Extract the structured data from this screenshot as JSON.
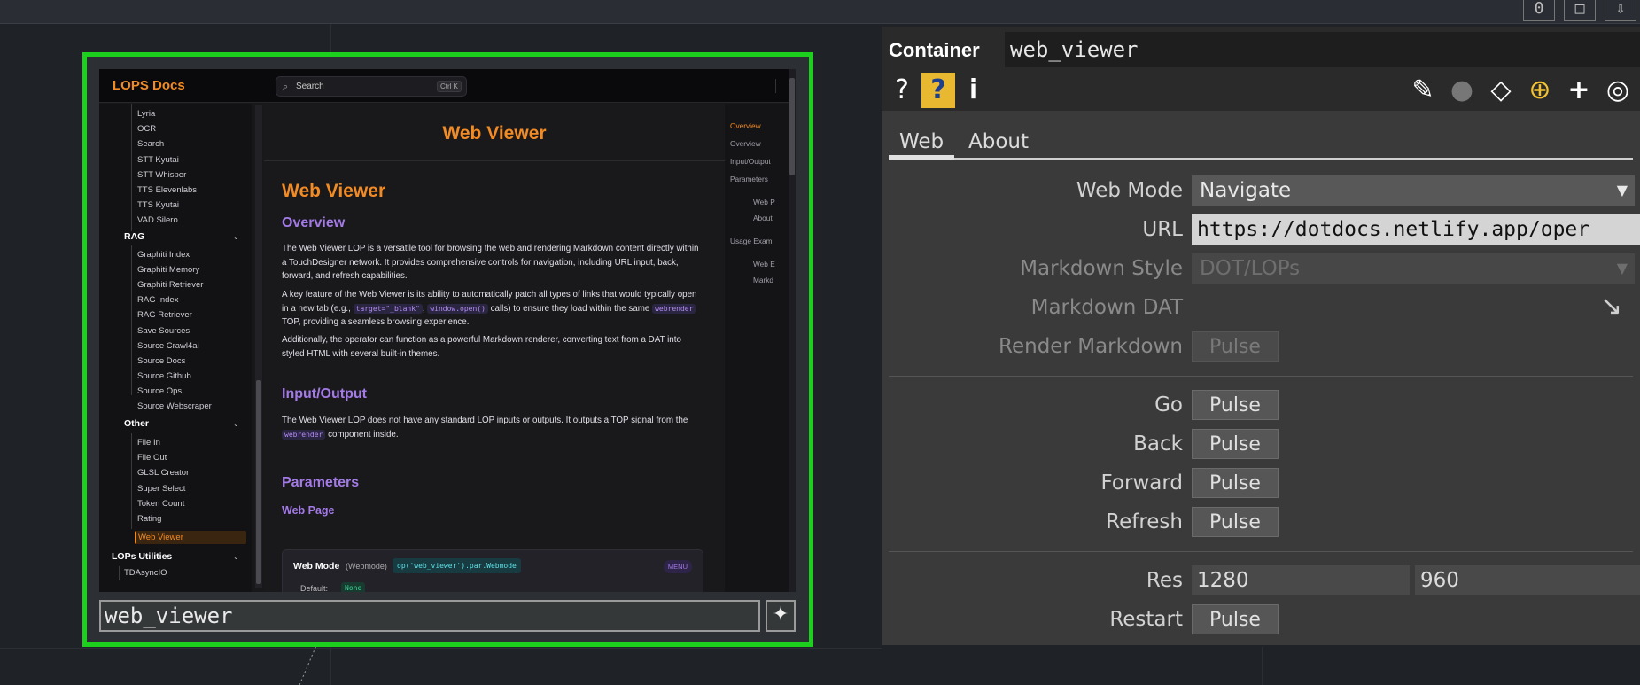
{
  "topbar": {
    "btn1": "0",
    "btn2": "□",
    "btn3": "⇩"
  },
  "docs": {
    "logo": "LOPS Docs",
    "search_placeholder": "Search",
    "search_kbd": "Ctrl K",
    "sidebar": {
      "items_top": [
        "Lyria",
        "OCR",
        "Search",
        "STT Kyutai",
        "STT Whisper",
        "TTS Elevenlabs",
        "TTS Kyutai",
        "VAD Silero"
      ],
      "section_rag": "RAG",
      "items_rag": [
        "Graphiti Index",
        "Graphiti Memory",
        "Graphiti Retriever",
        "RAG Index",
        "RAG Retriever",
        "Save Sources",
        "Source Crawl4ai",
        "Source Docs",
        "Source Github",
        "Source Ops",
        "Source Webscraper"
      ],
      "section_other": "Other",
      "items_other": [
        "File In",
        "File Out",
        "GLSL Creator",
        "Super Select",
        "Token Count",
        "Rating"
      ],
      "active_item": "Web Viewer",
      "section_utils": "LOPs Utilities",
      "items_utils": [
        "TDAsyncIO"
      ]
    },
    "content": {
      "hero": "Web Viewer",
      "title": "Web Viewer",
      "overview_heading": "Overview",
      "p1": "The Web Viewer LOP is a versatile tool for browsing the web and rendering Markdown content directly within a TouchDesigner network. It provides comprehensive controls for navigation, including URL input, back, forward, and refresh capabilities.",
      "p2_a": "A key feature of the Web Viewer is its ability to automatically patch all types of links that would typically open in a new tab (e.g., ",
      "p2_code1": "target=\"_blank\"",
      "p2_b": ", ",
      "p2_code2": "window.open()",
      "p2_c": " calls) to ensure they load within the same ",
      "p2_code3": "webrender",
      "p2_d": " TOP, providing a seamless browsing experience.",
      "p3": "Additionally, the operator can function as a powerful Markdown renderer, converting text from a DAT into styled HTML with several built-in themes.",
      "io_heading": "Input/Output",
      "io_p_a": "The Web Viewer LOP does not have any standard LOP inputs or outputs. It outputs a TOP signal from the ",
      "io_code": "webrender",
      "io_p_b": " component inside.",
      "params_heading": "Parameters",
      "webpage_heading": "Web Page",
      "param_name": "Web Mode",
      "param_alias": "(Webmode)",
      "param_code": "op('web_viewer').par.Webmode",
      "param_tag": "MENU",
      "param_default_label": "Default:",
      "param_default_value": "None"
    },
    "toc": [
      "Overview",
      "Overview",
      "Input/Output",
      "Parameters",
      "Web P",
      "About",
      "Usage Exam",
      "Web E",
      "Markd"
    ]
  },
  "node": {
    "name": "web_viewer",
    "add_icon": "✦"
  },
  "panel": {
    "type": "Container",
    "name": "web_viewer",
    "icons": [
      "?",
      "?",
      "i",
      "✎",
      "●",
      "◇",
      "⊕",
      "+",
      "◎"
    ],
    "tabs": [
      "Web",
      "About"
    ],
    "web_mode_label": "Web Mode",
    "web_mode_value": "Navigate",
    "url_label": "URL",
    "url_value": "https://dotdocs.netlify.app/oper",
    "markdown_style_label": "Markdown Style",
    "markdown_style_value": "DOT/LOPs",
    "markdown_dat_label": "Markdown DAT",
    "render_markdown_label": "Render Markdown",
    "go_label": "Go",
    "back_label": "Back",
    "forward_label": "Forward",
    "refresh_label": "Refresh",
    "res_label": "Res",
    "res_w": "1280",
    "res_h": "960",
    "restart_label": "Restart",
    "pulse": "Pulse"
  }
}
